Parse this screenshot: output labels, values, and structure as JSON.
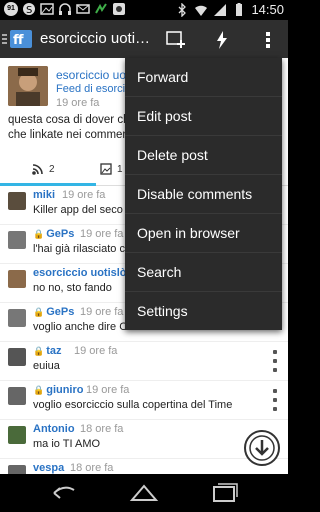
{
  "status_bar": {
    "notification_count": "91",
    "time": "14:50"
  },
  "action_bar": {
    "title": "esorciccio uoti…"
  },
  "post": {
    "author": "esorciccio uoti",
    "feed": "Feed di esorcic",
    "time": "19 ore fa",
    "text_line1": "questa cosa di dover cl",
    "text_line2": "che linkate nei commen"
  },
  "tabs": [
    {
      "icon": "rss-icon",
      "count": "2"
    },
    {
      "icon": "image-icon",
      "count": "1"
    }
  ],
  "comments": [
    {
      "author": "miki",
      "time": "19 ore fa",
      "text": "Killer app del seco",
      "locked": false
    },
    {
      "author": "GePs",
      "time": "19 ore fa",
      "text": "l'hai già rilasciato c",
      "locked": true
    },
    {
      "author": "esorciccio uotislòt",
      "time": "",
      "text": "no no, sto fando",
      "locked": false
    },
    {
      "author": "GePs",
      "time": "19 ore fa",
      "text": "voglio anche dire CH",
      "locked": true
    },
    {
      "author": "taz",
      "time": "19 ore fa",
      "text": "euiua",
      "locked": true
    },
    {
      "author": "giuniro",
      "time": "19 ore fa",
      "text": "voglio esorciccio sulla copertina del Time",
      "locked": true
    },
    {
      "author": "Antonio",
      "time": "18 ore fa",
      "text": "ma io TI AMO",
      "locked": false
    },
    {
      "author": "vespa",
      "time": "18 ore fa",
      "text": "",
      "locked": false
    }
  ],
  "overflow_menu": {
    "items": [
      "Forward",
      "Edit post",
      "Delete post",
      "Disable comments",
      "Open in browser",
      "Search",
      "Settings"
    ]
  },
  "colors": {
    "accent": "#33b5e5",
    "link": "#2a73c4",
    "menu_bg": "#2b2b2b",
    "action_bar_bg": "#2f2f2f"
  }
}
